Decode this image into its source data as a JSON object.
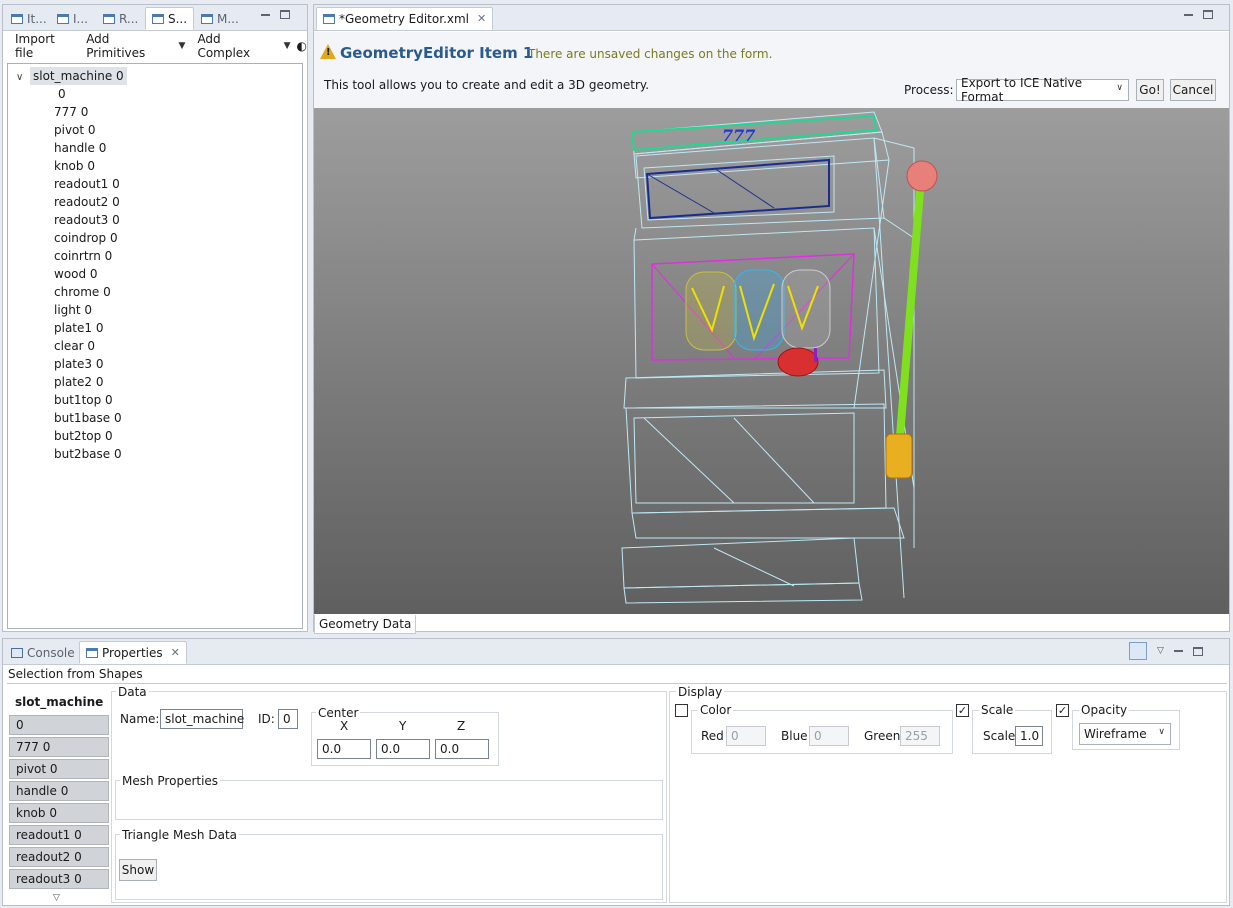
{
  "left_panel": {
    "tabs": [
      "It...",
      "I...",
      "R...",
      "S...",
      "M..."
    ],
    "toolbar": {
      "import": "Import file",
      "add_primitives": "Add Primitives",
      "add_complex": "Add Complex"
    },
    "tree": {
      "root": "slot_machine 0",
      "items": [
        "0",
        "777 0",
        "pivot 0",
        "handle 0",
        "knob 0",
        "readout1 0",
        "readout2 0",
        "readout3 0",
        "coindrop 0",
        "coinrtrn 0",
        "wood 0",
        "chrome 0",
        "light 0",
        "plate1 0",
        "clear 0",
        "plate3 0",
        "plate2 0",
        "but1top 0",
        "but1base 0",
        "but2top 0",
        "but2base 0"
      ]
    }
  },
  "editor": {
    "tab_label": "*Geometry Editor.xml",
    "title": "GeometryEditor Item 1",
    "warning": "There are unsaved changes on the form.",
    "description": "This tool allows you to create and edit a 3D geometry.",
    "process_label": "Process:",
    "process_value": "Export to ICE Native Format",
    "go_label": "Go!",
    "cancel_label": "Cancel",
    "bottom_tab": "Geometry Data",
    "display_text": "777"
  },
  "bottom": {
    "tabs": {
      "console": "Console",
      "properties": "Properties"
    },
    "selection_title": "Selection from Shapes",
    "list": [
      "slot_machine 0",
      "0",
      "777 0",
      "pivot 0",
      "handle 0",
      "knob 0",
      "readout1 0",
      "readout2 0",
      "readout3 0"
    ],
    "data": {
      "group": "Data",
      "name_label": "Name:",
      "name_value": "slot_machine",
      "id_label": "ID:",
      "id_value": "0",
      "center_label": "Center",
      "x_label": "X",
      "y_label": "Y",
      "z_label": "Z",
      "x": "0.0",
      "y": "0.0",
      "z": "0.0",
      "mesh_props": "Mesh Properties",
      "tri_mesh": "Triangle Mesh Data",
      "show": "Show"
    },
    "display": {
      "group": "Display",
      "color_label": "Color",
      "red_label": "Red",
      "red": "0",
      "blue_label": "Blue",
      "blue": "0",
      "green_label": "Green",
      "green": "255",
      "scale_group": "Scale",
      "scale_label": "Scale",
      "scale": "1.0",
      "opacity_label": "Opacity",
      "mode": "Wireframe"
    }
  },
  "colors": {
    "title": "#2a5a8e",
    "warning": "#7a7a1e",
    "tab_bg": "#e6ebf1"
  }
}
